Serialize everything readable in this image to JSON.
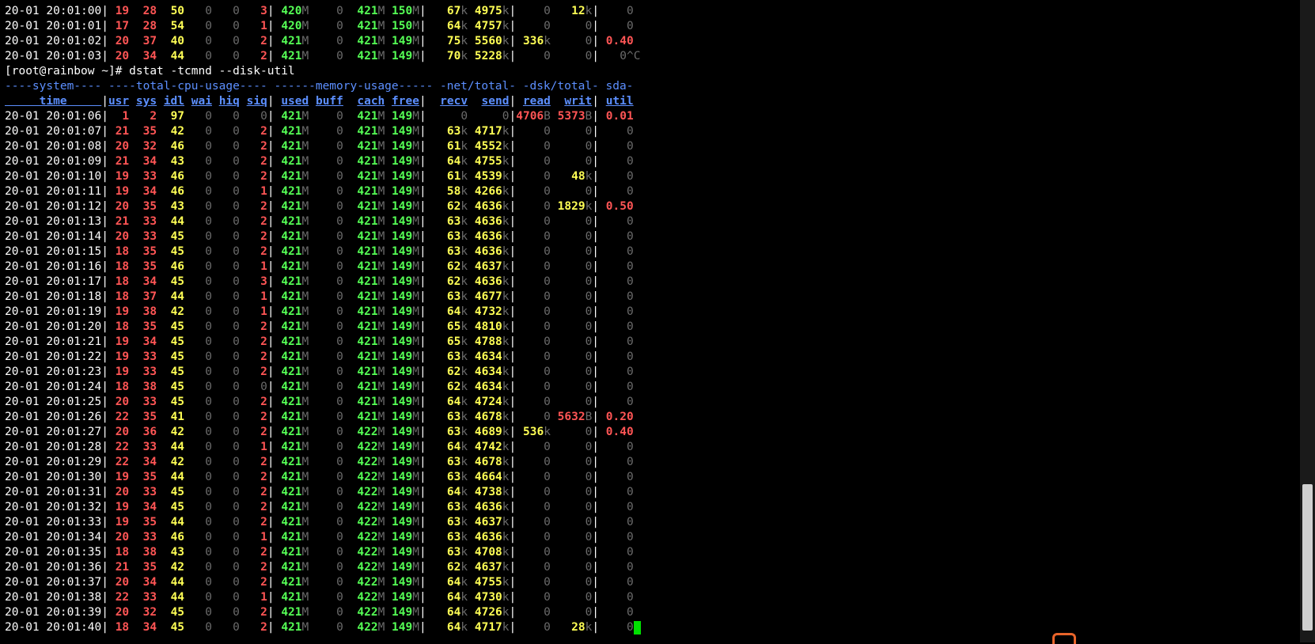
{
  "terminal": {
    "prompt": "[root@rainbow ~]# ",
    "command": "dstat -tcmnd --disk-util",
    "group_header": "----system---- ----total-cpu-usage---- ------memory-usage----- -net/total- -dsk/total- sda-",
    "columns": [
      "time",
      "usr",
      "sys",
      "idl",
      "wai",
      "hiq",
      "siq",
      "used",
      "buff",
      "cach",
      "free",
      "recv",
      "send",
      "read",
      "writ",
      "util"
    ],
    "pre_rows": [
      [
        "20-01 20:01:00",
        "19",
        "28",
        "50",
        "0",
        "0",
        "3",
        "420M",
        "0",
        "421M",
        "150M",
        "67k",
        "4975k",
        "0",
        "12k",
        "0"
      ],
      [
        "20-01 20:01:01",
        "17",
        "28",
        "54",
        "0",
        "0",
        "1",
        "420M",
        "0",
        "421M",
        "150M",
        "64k",
        "4757k",
        "0",
        "0",
        "0"
      ],
      [
        "20-01 20:01:02",
        "20",
        "37",
        "40",
        "0",
        "0",
        "2",
        "421M",
        "0",
        "421M",
        "149M",
        "75k",
        "5560k",
        "336k",
        "0",
        "0.40"
      ],
      [
        "20-01 20:01:03",
        "20",
        "34",
        "44",
        "0",
        "0",
        "2",
        "421M",
        "0",
        "421M",
        "149M",
        "70k",
        "5228k",
        "0",
        "0",
        "0^C"
      ]
    ],
    "rows": [
      [
        "20-01 20:01:06",
        "1",
        "2",
        "97",
        "0",
        "0",
        "0",
        "421M",
        "0",
        "421M",
        "149M",
        "0",
        "0",
        "4706B",
        "5373B",
        "0.01"
      ],
      [
        "20-01 20:01:07",
        "21",
        "35",
        "42",
        "0",
        "0",
        "2",
        "421M",
        "0",
        "421M",
        "149M",
        "63k",
        "4717k",
        "0",
        "0",
        "0"
      ],
      [
        "20-01 20:01:08",
        "20",
        "32",
        "46",
        "0",
        "0",
        "2",
        "421M",
        "0",
        "421M",
        "149M",
        "61k",
        "4552k",
        "0",
        "0",
        "0"
      ],
      [
        "20-01 20:01:09",
        "21",
        "34",
        "43",
        "0",
        "0",
        "2",
        "421M",
        "0",
        "421M",
        "149M",
        "64k",
        "4755k",
        "0",
        "0",
        "0"
      ],
      [
        "20-01 20:01:10",
        "19",
        "33",
        "46",
        "0",
        "0",
        "2",
        "421M",
        "0",
        "421M",
        "149M",
        "61k",
        "4539k",
        "0",
        "48k",
        "0"
      ],
      [
        "20-01 20:01:11",
        "19",
        "34",
        "46",
        "0",
        "0",
        "1",
        "421M",
        "0",
        "421M",
        "149M",
        "58k",
        "4266k",
        "0",
        "0",
        "0"
      ],
      [
        "20-01 20:01:12",
        "20",
        "35",
        "43",
        "0",
        "0",
        "2",
        "421M",
        "0",
        "421M",
        "149M",
        "62k",
        "4636k",
        "0",
        "1829k",
        "0.50"
      ],
      [
        "20-01 20:01:13",
        "21",
        "33",
        "44",
        "0",
        "0",
        "2",
        "421M",
        "0",
        "421M",
        "149M",
        "63k",
        "4636k",
        "0",
        "0",
        "0"
      ],
      [
        "20-01 20:01:14",
        "20",
        "33",
        "45",
        "0",
        "0",
        "2",
        "421M",
        "0",
        "421M",
        "149M",
        "63k",
        "4636k",
        "0",
        "0",
        "0"
      ],
      [
        "20-01 20:01:15",
        "18",
        "35",
        "45",
        "0",
        "0",
        "2",
        "421M",
        "0",
        "421M",
        "149M",
        "63k",
        "4636k",
        "0",
        "0",
        "0"
      ],
      [
        "20-01 20:01:16",
        "18",
        "35",
        "46",
        "0",
        "0",
        "1",
        "421M",
        "0",
        "421M",
        "149M",
        "62k",
        "4637k",
        "0",
        "0",
        "0"
      ],
      [
        "20-01 20:01:17",
        "18",
        "34",
        "45",
        "0",
        "0",
        "3",
        "421M",
        "0",
        "421M",
        "149M",
        "62k",
        "4636k",
        "0",
        "0",
        "0"
      ],
      [
        "20-01 20:01:18",
        "18",
        "37",
        "44",
        "0",
        "0",
        "1",
        "421M",
        "0",
        "421M",
        "149M",
        "63k",
        "4677k",
        "0",
        "0",
        "0"
      ],
      [
        "20-01 20:01:19",
        "19",
        "38",
        "42",
        "0",
        "0",
        "1",
        "421M",
        "0",
        "421M",
        "149M",
        "64k",
        "4732k",
        "0",
        "0",
        "0"
      ],
      [
        "20-01 20:01:20",
        "18",
        "35",
        "45",
        "0",
        "0",
        "2",
        "421M",
        "0",
        "421M",
        "149M",
        "65k",
        "4810k",
        "0",
        "0",
        "0"
      ],
      [
        "20-01 20:01:21",
        "19",
        "34",
        "45",
        "0",
        "0",
        "2",
        "421M",
        "0",
        "421M",
        "149M",
        "65k",
        "4788k",
        "0",
        "0",
        "0"
      ],
      [
        "20-01 20:01:22",
        "19",
        "33",
        "45",
        "0",
        "0",
        "2",
        "421M",
        "0",
        "421M",
        "149M",
        "63k",
        "4634k",
        "0",
        "0",
        "0"
      ],
      [
        "20-01 20:01:23",
        "19",
        "33",
        "45",
        "0",
        "0",
        "2",
        "421M",
        "0",
        "421M",
        "149M",
        "62k",
        "4634k",
        "0",
        "0",
        "0"
      ],
      [
        "20-01 20:01:24",
        "18",
        "38",
        "45",
        "0",
        "0",
        "0",
        "421M",
        "0",
        "421M",
        "149M",
        "62k",
        "4634k",
        "0",
        "0",
        "0"
      ],
      [
        "20-01 20:01:25",
        "20",
        "33",
        "45",
        "0",
        "0",
        "2",
        "421M",
        "0",
        "421M",
        "149M",
        "64k",
        "4724k",
        "0",
        "0",
        "0"
      ],
      [
        "20-01 20:01:26",
        "22",
        "35",
        "41",
        "0",
        "0",
        "2",
        "421M",
        "0",
        "421M",
        "149M",
        "63k",
        "4678k",
        "0",
        "5632B",
        "0.20"
      ],
      [
        "20-01 20:01:27",
        "20",
        "36",
        "42",
        "0",
        "0",
        "2",
        "421M",
        "0",
        "422M",
        "149M",
        "63k",
        "4689k",
        "536k",
        "0",
        "0.40"
      ],
      [
        "20-01 20:01:28",
        "22",
        "33",
        "44",
        "0",
        "0",
        "1",
        "421M",
        "0",
        "422M",
        "149M",
        "64k",
        "4742k",
        "0",
        "0",
        "0"
      ],
      [
        "20-01 20:01:29",
        "22",
        "34",
        "42",
        "0",
        "0",
        "2",
        "421M",
        "0",
        "422M",
        "149M",
        "63k",
        "4678k",
        "0",
        "0",
        "0"
      ],
      [
        "20-01 20:01:30",
        "19",
        "35",
        "44",
        "0",
        "0",
        "2",
        "421M",
        "0",
        "422M",
        "149M",
        "63k",
        "4664k",
        "0",
        "0",
        "0"
      ],
      [
        "20-01 20:01:31",
        "20",
        "33",
        "45",
        "0",
        "0",
        "2",
        "421M",
        "0",
        "422M",
        "149M",
        "64k",
        "4738k",
        "0",
        "0",
        "0"
      ],
      [
        "20-01 20:01:32",
        "19",
        "34",
        "45",
        "0",
        "0",
        "2",
        "421M",
        "0",
        "422M",
        "149M",
        "63k",
        "4636k",
        "0",
        "0",
        "0"
      ],
      [
        "20-01 20:01:33",
        "19",
        "35",
        "44",
        "0",
        "0",
        "2",
        "421M",
        "0",
        "422M",
        "149M",
        "63k",
        "4637k",
        "0",
        "0",
        "0"
      ],
      [
        "20-01 20:01:34",
        "20",
        "33",
        "46",
        "0",
        "0",
        "1",
        "421M",
        "0",
        "422M",
        "149M",
        "63k",
        "4636k",
        "0",
        "0",
        "0"
      ],
      [
        "20-01 20:01:35",
        "18",
        "38",
        "43",
        "0",
        "0",
        "2",
        "421M",
        "0",
        "422M",
        "149M",
        "63k",
        "4708k",
        "0",
        "0",
        "0"
      ],
      [
        "20-01 20:01:36",
        "21",
        "35",
        "42",
        "0",
        "0",
        "2",
        "421M",
        "0",
        "422M",
        "149M",
        "62k",
        "4637k",
        "0",
        "0",
        "0"
      ],
      [
        "20-01 20:01:37",
        "20",
        "34",
        "44",
        "0",
        "0",
        "2",
        "421M",
        "0",
        "422M",
        "149M",
        "64k",
        "4755k",
        "0",
        "0",
        "0"
      ],
      [
        "20-01 20:01:38",
        "22",
        "33",
        "44",
        "0",
        "0",
        "1",
        "421M",
        "0",
        "422M",
        "149M",
        "64k",
        "4730k",
        "0",
        "0",
        "0"
      ],
      [
        "20-01 20:01:39",
        "20",
        "32",
        "45",
        "0",
        "0",
        "2",
        "421M",
        "0",
        "422M",
        "149M",
        "64k",
        "4726k",
        "0",
        "0",
        "0"
      ],
      [
        "20-01 20:01:40",
        "18",
        "34",
        "45",
        "0",
        "0",
        "2",
        "421M",
        "0",
        "422M",
        "149M",
        "64k",
        "4717k",
        "0",
        "28k",
        "0"
      ]
    ]
  },
  "colors": {
    "background": "#000000",
    "cpu_usr_sys": "#ff5555",
    "idle_net": "#ffff55",
    "memory": "#55ff55",
    "header_blue": "#5c8fff",
    "dim": "#6b6b6b",
    "cursor": "#00e000"
  }
}
